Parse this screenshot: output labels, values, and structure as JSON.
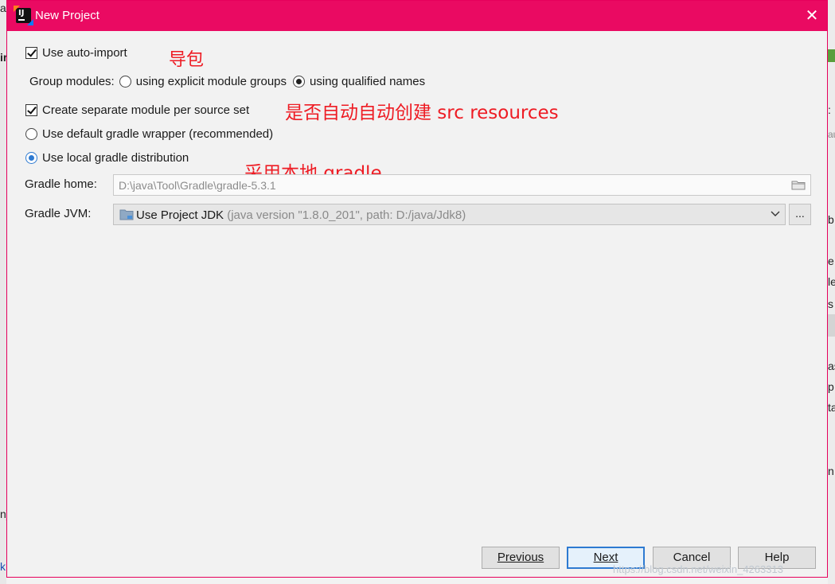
{
  "background": {
    "left_fragments": [
      "a",
      "ir",
      "n]",
      "k"
    ],
    "right_fragments": [
      ":",
      "au",
      "b",
      "e",
      "le",
      "s",
      "as",
      "p",
      "ta",
      "n"
    ]
  },
  "dialog": {
    "title": "New Project",
    "accent_color": "#ea0a62"
  },
  "options": {
    "auto_import_label": "Use auto-import",
    "group_modules_label": "Group modules:",
    "group_explicit_label": "using explicit module groups",
    "group_qualified_label": "using qualified names",
    "separate_module_label": "Create separate module per source set",
    "default_wrapper_label": "Use default gradle wrapper (recommended)",
    "local_dist_label": "Use local gradle distribution",
    "gradle_home_label": "Gradle home:",
    "gradle_home_value": "D:\\java\\Tool\\Gradle\\gradle-5.3.1",
    "gradle_jvm_label": "Gradle JVM:",
    "gradle_jvm_value": "Use Project JDK",
    "gradle_jvm_detail": "(java version \"1.8.0_201\", path: D:/java/Jdk8)",
    "browse_label": "..."
  },
  "annotations": {
    "auto_import": "导包",
    "separate_module": "是否自动自动创建  src  resources",
    "local_gradle": "采用本地  gradle"
  },
  "buttons": {
    "previous": "Previous",
    "next": "Next",
    "cancel": "Cancel",
    "help": "Help"
  },
  "watermark": "https://blog.csdn.net/weixin_4263313"
}
